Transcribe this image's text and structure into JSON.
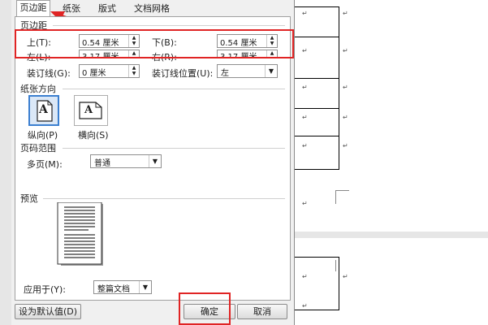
{
  "tabs": [
    {
      "label": "页边距"
    },
    {
      "label": "纸张"
    },
    {
      "label": "版式"
    },
    {
      "label": "文档网格"
    }
  ],
  "margins": {
    "section_title": "页边距",
    "top_label": "上(T):",
    "top_value": "0.54 厘米",
    "bottom_label": "下(B):",
    "bottom_value": "0.54 厘米",
    "left_label": "左(L):",
    "left_value": "3.17 厘米",
    "right_label": "右(R):",
    "right_value": "3.17 厘米",
    "gutter_label": "装订线(G):",
    "gutter_value": "0 厘米",
    "gutter_pos_label": "装订线位置(U):",
    "gutter_pos_value": "左"
  },
  "orientation": {
    "section_title": "纸张方向",
    "portrait_label": "纵向(P)",
    "landscape_label": "横向(S)",
    "glyph": "A"
  },
  "pages": {
    "section_title": "页码范围",
    "multi_label": "多页(M):",
    "multi_value": "普通"
  },
  "preview": {
    "section_title": "预览"
  },
  "apply": {
    "label": "应用于(Y):",
    "value": "整篇文档"
  },
  "buttons": {
    "default": "设为默认值(D)",
    "ok": "确定",
    "cancel": "取消"
  },
  "doc_marker": "↵",
  "colors": {
    "highlight": "#e02424",
    "selected": "#3b7fd0"
  }
}
